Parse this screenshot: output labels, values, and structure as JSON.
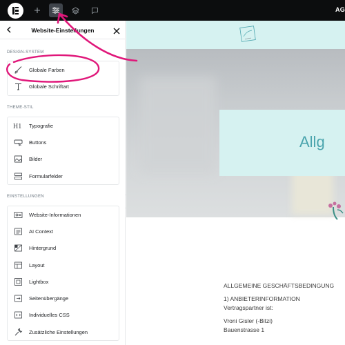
{
  "topbar": {
    "right_label": "AG"
  },
  "panel": {
    "title": "Website-Einstellungen",
    "sections": [
      {
        "title": "DESIGN-SYSTEM",
        "items": [
          {
            "label": "Globale Farben",
            "icon": "brush-icon"
          },
          {
            "label": "Globale Schriftart",
            "icon": "typography-t-icon"
          }
        ]
      },
      {
        "title": "THEME-STIL",
        "items": [
          {
            "label": "Typografie",
            "icon": "heading-h1-icon"
          },
          {
            "label": "Buttons",
            "icon": "button-cursor-icon"
          },
          {
            "label": "Bilder",
            "icon": "image-icon"
          },
          {
            "label": "Formularfelder",
            "icon": "form-fields-icon"
          }
        ]
      },
      {
        "title": "EINSTELLUNGEN",
        "items": [
          {
            "label": "Website-Informationen",
            "icon": "site-info-icon"
          },
          {
            "label": "AI Context",
            "icon": "ai-context-icon"
          },
          {
            "label": "Hintergrund",
            "icon": "background-icon"
          },
          {
            "label": "Layout",
            "icon": "layout-icon"
          },
          {
            "label": "Lightbox",
            "icon": "lightbox-icon"
          },
          {
            "label": "Seitenübergänge",
            "icon": "page-transitions-icon"
          },
          {
            "label": "Individuelles CSS",
            "icon": "code-icon"
          },
          {
            "label": "Zusätzliche Einstellungen",
            "icon": "wrench-icon"
          }
        ]
      }
    ]
  },
  "preview": {
    "hero_title": "Allg",
    "content": {
      "heading": "ALLGEMEINE GESCHÄFTSBEDINGUNG",
      "section1": "1) ANBIETERINFORMATION",
      "line1": "Vertragspartner ist:",
      "name": "Vroni Gisler (-Bitzi)",
      "street": "Bauenstrasse 1"
    }
  },
  "colors": {
    "topbar": "#0c0d0e",
    "accent_annotation": "#e0177a",
    "preview_mint": "#d6f2f1",
    "hero_title": "#4aa4ad"
  }
}
